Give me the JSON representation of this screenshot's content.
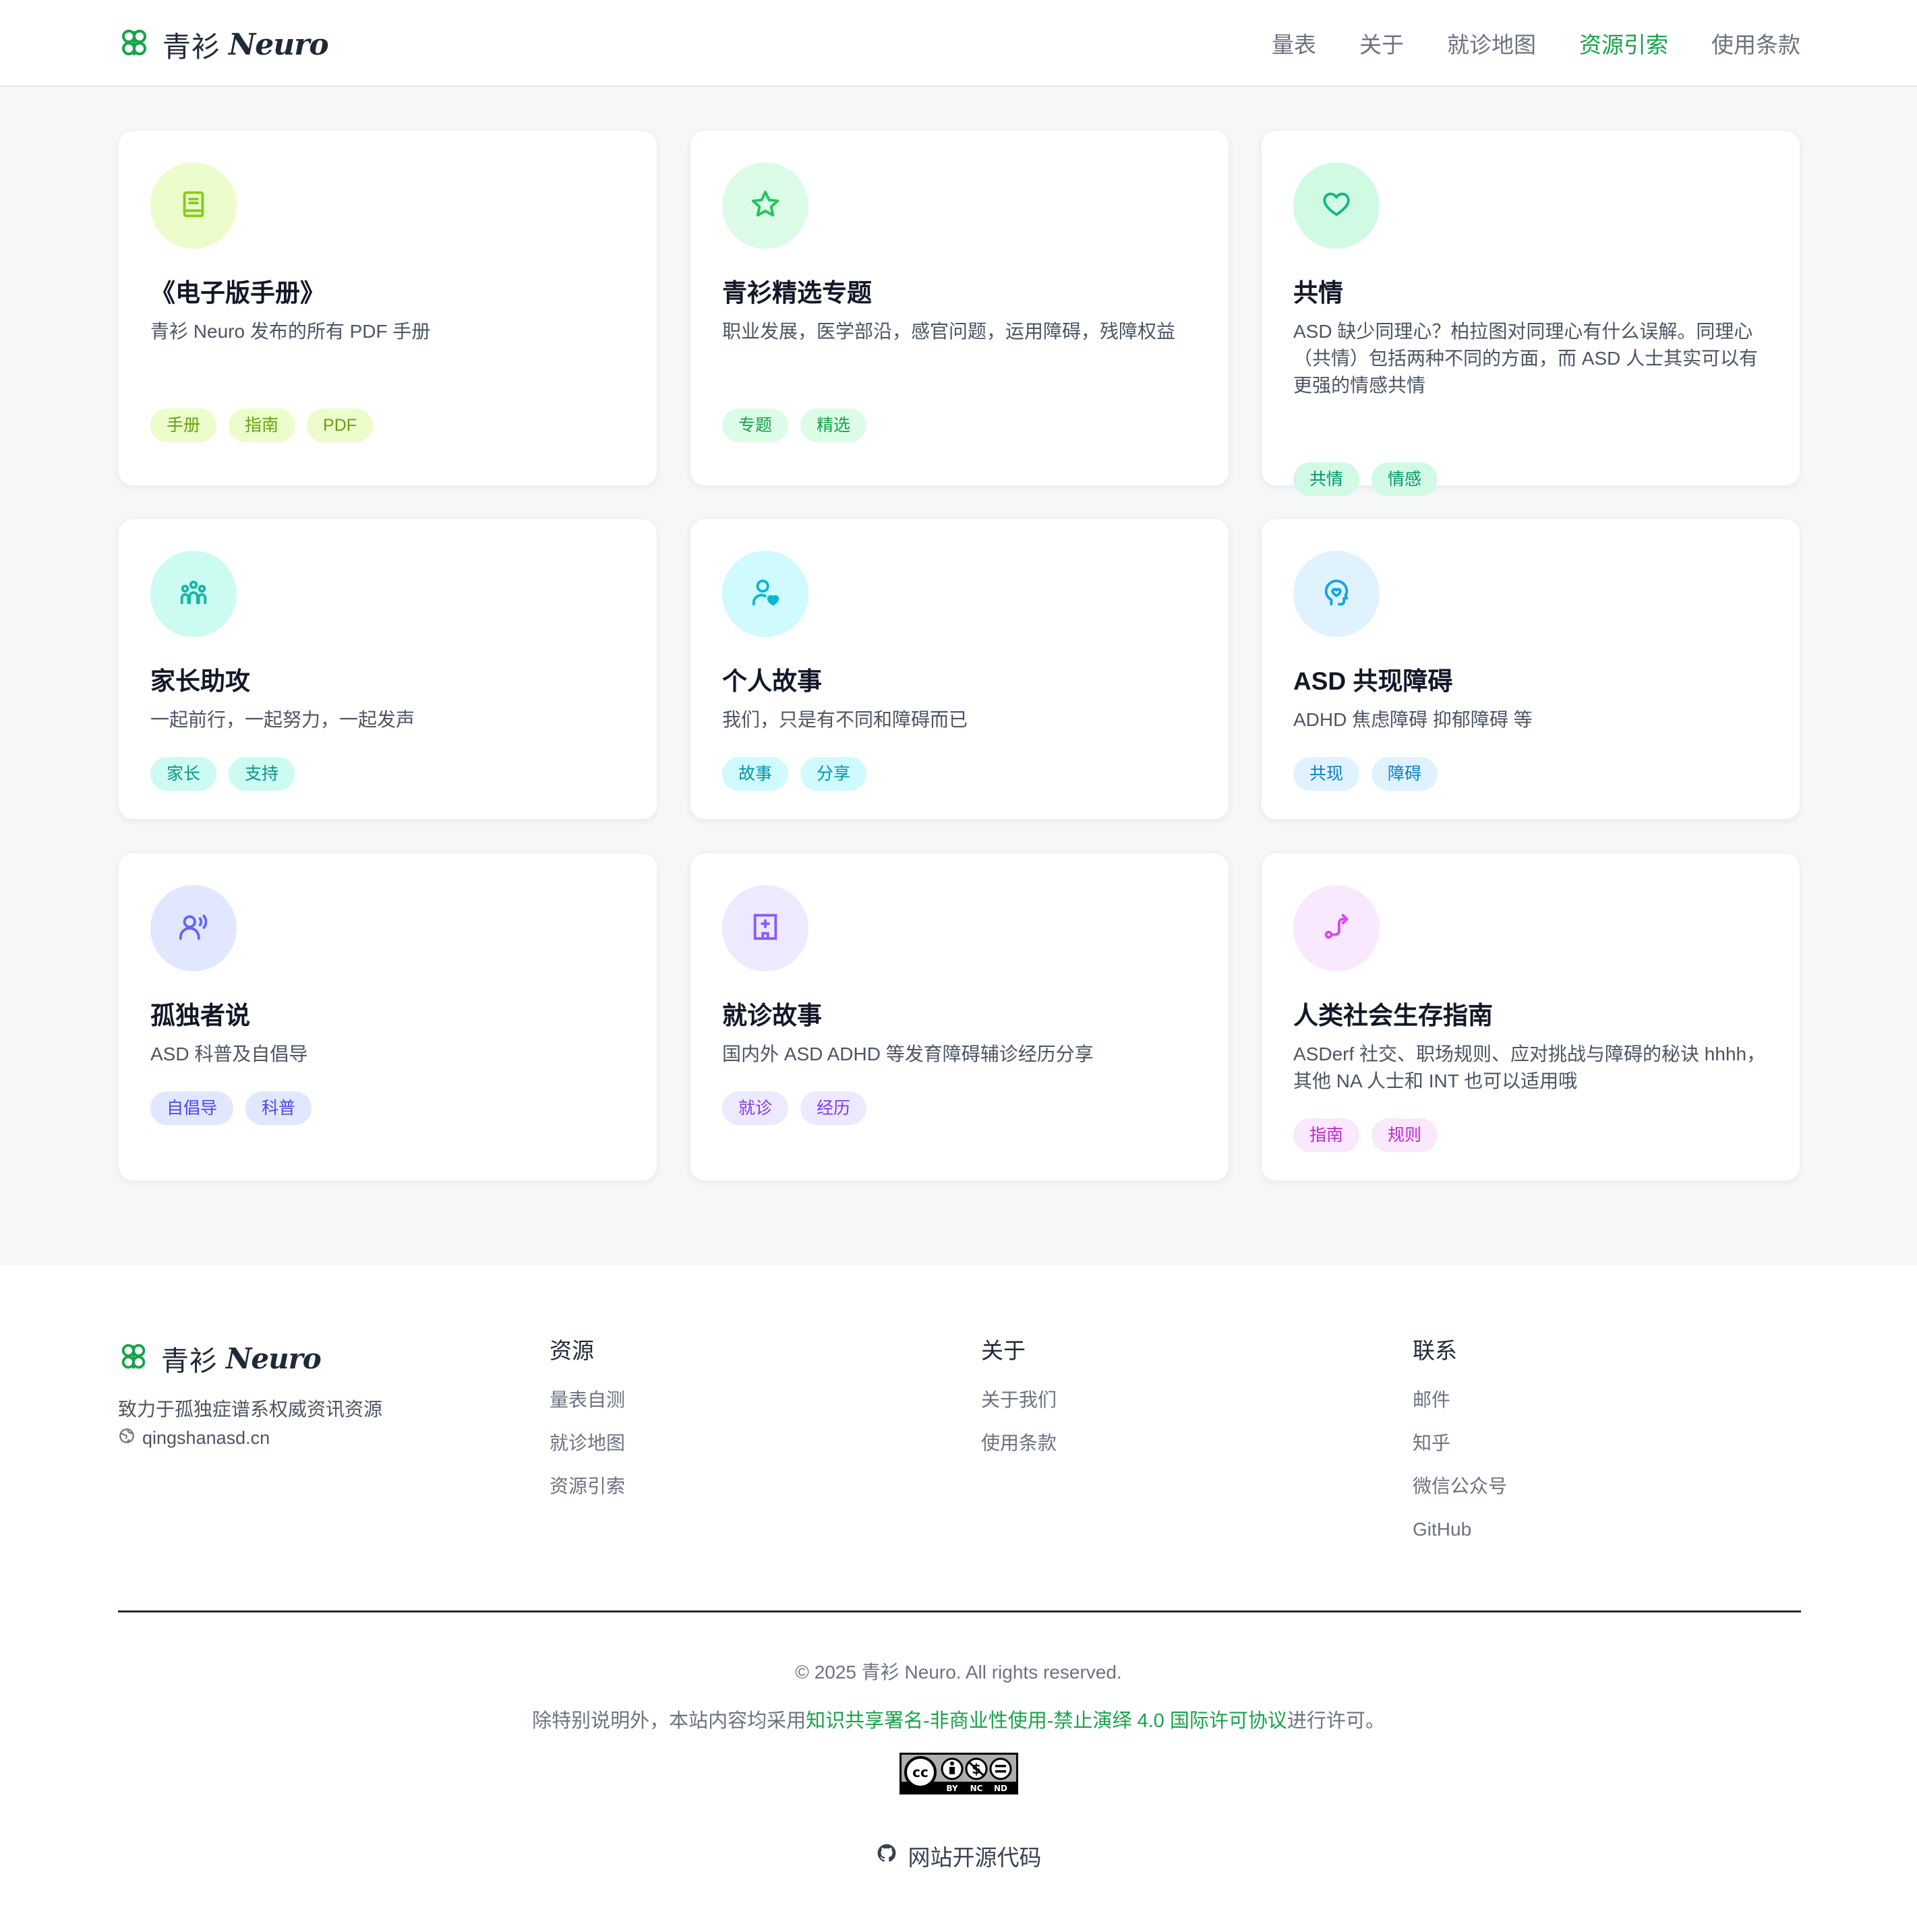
{
  "brand": {
    "name_cn": "青衫",
    "name_en": "Neuro"
  },
  "nav": {
    "items": [
      {
        "label": "量表",
        "active": false
      },
      {
        "label": "关于",
        "active": false
      },
      {
        "label": "就诊地图",
        "active": false
      },
      {
        "label": "资源引索",
        "active": true
      },
      {
        "label": "使用条款",
        "active": false
      }
    ]
  },
  "cards": [
    {
      "title": "《电子版手册》",
      "desc": "青衫 Neuro 发布的所有 PDF 手册",
      "tags": [
        "手册",
        "指南",
        "PDF"
      ],
      "icon": "book-icon",
      "accent": "#84cc16",
      "tint": "#ecfccb"
    },
    {
      "title": "青衫精选专题",
      "desc": "职业发展，医学部沿，感官问题，运用障碍，残障权益",
      "tags": [
        "专题",
        "精选"
      ],
      "icon": "star-icon",
      "accent": "#22c55e",
      "tint": "#dcfce7"
    },
    {
      "title": "共情",
      "desc": "ASD 缺少同理心？柏拉图对同理心有什么误解。同理心（共情）包括两种不同的方面，而 ASD 人士其实可以有更强的情感共情",
      "tags": [
        "共情",
        "情感"
      ],
      "icon": "heart-icon",
      "accent": "#10b981",
      "tint": "#d1fae5"
    },
    {
      "title": "家长助攻",
      "desc": "一起前行，一起努力，一起发声",
      "tags": [
        "家长",
        "支持"
      ],
      "icon": "family-icon",
      "accent": "#14b8a6",
      "tint": "#ccfbf1"
    },
    {
      "title": "个人故事",
      "desc": "我们，只是有不同和障碍而已",
      "tags": [
        "故事",
        "分享"
      ],
      "icon": "user-heart-icon",
      "accent": "#06b6d4",
      "tint": "#cffafe"
    },
    {
      "title": "ASD 共现障碍",
      "desc": "ADHD 焦虑障碍 抑郁障碍 等",
      "tags": [
        "共现",
        "障碍"
      ],
      "icon": "brain-head-icon",
      "accent": "#0ea5e9",
      "tint": "#e0f2fe"
    },
    {
      "title": "孤独者说",
      "desc": "ASD 科普及自倡导",
      "tags": [
        "自倡导",
        "科普"
      ],
      "icon": "speaking-person-icon",
      "accent": "#6366f1",
      "tint": "#e0e7ff"
    },
    {
      "title": "就诊故事",
      "desc": "国内外 ASD ADHD 等发育障碍辅诊经历分享",
      "tags": [
        "就诊",
        "经历"
      ],
      "icon": "hospital-icon",
      "accent": "#8b5cf6",
      "tint": "#ede9fe"
    },
    {
      "title": "人类社会生存指南",
      "desc": "ASDerf 社交、职场规则、应对挑战与障碍的秘诀 hhhh，其他 NA 人士和 INT 也可以适用哦",
      "tags": [
        "指南",
        "规则"
      ],
      "icon": "route-icon",
      "accent": "#d946ef",
      "tint": "#fae8ff"
    }
  ],
  "footer": {
    "tagline": "致力于孤独症谱系权威资讯资源",
    "site": "qingshanasd.cn",
    "columns": [
      {
        "title": "资源",
        "links": [
          "量表自测",
          "就诊地图",
          "资源引索"
        ]
      },
      {
        "title": "关于",
        "links": [
          "关于我们",
          "使用条款"
        ]
      },
      {
        "title": "联系",
        "links": [
          "邮件",
          "知乎",
          "微信公众号",
          "GitHub"
        ]
      }
    ],
    "copyright": "© 2025 青衫 Neuro. All rights reserved.",
    "license_prefix": "除特别说明外，本站内容均采用",
    "license_link": "知识共享署名-非商业性使用-禁止演绎 4.0 国际许可协议",
    "license_suffix": "进行许可。",
    "cc_badge": {
      "marks": [
        "BY",
        "NC",
        "ND"
      ]
    },
    "source_link": "网站开源代码"
  },
  "colors": {
    "accent": "#16a34a",
    "page_bg": "#f6f7f9",
    "card_bg": "#ffffff"
  }
}
